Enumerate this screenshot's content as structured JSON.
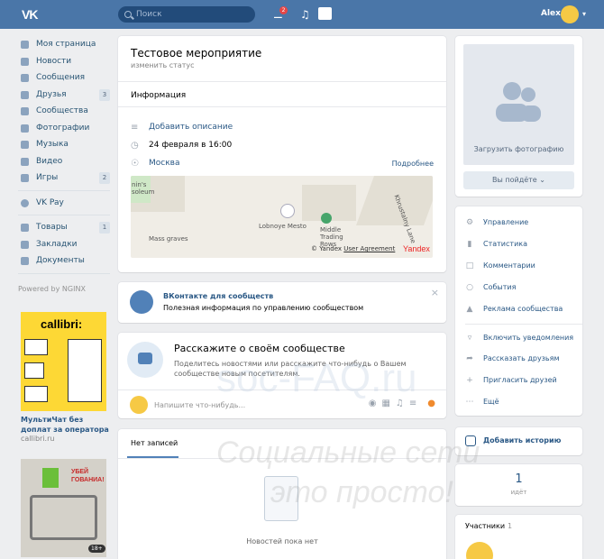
{
  "topbar": {
    "logo": "VK",
    "search_placeholder": "Поиск",
    "notif_count": "2",
    "user_name": "Alex"
  },
  "sidebar": {
    "items": [
      {
        "label": "Моя страница",
        "count": ""
      },
      {
        "label": "Новости",
        "count": ""
      },
      {
        "label": "Сообщения",
        "count": ""
      },
      {
        "label": "Друзья",
        "count": "3"
      },
      {
        "label": "Сообщества",
        "count": ""
      },
      {
        "label": "Фотографии",
        "count": ""
      },
      {
        "label": "Музыка",
        "count": ""
      },
      {
        "label": "Видео",
        "count": ""
      },
      {
        "label": "Игры",
        "count": "2"
      }
    ],
    "vkpay": "VK Pay",
    "items2": [
      {
        "label": "Товары",
        "count": "1"
      },
      {
        "label": "Закладки",
        "count": ""
      },
      {
        "label": "Документы",
        "count": ""
      }
    ],
    "powered": "Powered by NGINX",
    "ad1": {
      "title": "callibri:",
      "caption": "МультиЧат без доплат за оператора",
      "url": "callibri.ru"
    },
    "ad2": {
      "title": "УБЕЙ ГОВАНИА!",
      "age": "18+"
    }
  },
  "event": {
    "title": "Тестовое мероприятие",
    "status": "изменить статус",
    "info_label": "Информация",
    "add_desc": "Добавить описание",
    "date": "24 февраля в 16:00",
    "city": "Москва",
    "more": "Подробнее",
    "map": {
      "lbl1": "nin's",
      "lbl2": "soleum",
      "lbl3": "Mass graves",
      "lbl4": "Lobnoye Mesto",
      "lbl5": "Middle Trading Rows",
      "lbl6": "Khrustalny Lane",
      "copyright": "© Yandex",
      "agreement": "User Agreement",
      "yandex": "Yandex"
    }
  },
  "community_info": {
    "title": "ВКонтакте для сообществ",
    "subtitle": "Полезная информация по управлению сообществом",
    "close": "×"
  },
  "tell": {
    "title": "Расскажите о своём сообществе",
    "subtitle": "Поделитесь новостями или расскажите что-нибудь о Вашем сообществе новым посетителям.",
    "placeholder": "Напишите что-нибудь..."
  },
  "posts": {
    "tab": "Нет записей",
    "empty": "Новостей пока нет"
  },
  "photo": {
    "upload": "Загрузить фотографию",
    "go_button": "Вы пойдёте"
  },
  "menu": {
    "items": [
      "Управление",
      "Статистика",
      "Комментарии",
      "События",
      "Реклама сообщества"
    ],
    "items2": [
      "Включить уведомления",
      "Рассказать друзьям",
      "Пригласить друзей",
      "Ещё"
    ]
  },
  "story": {
    "label": "Добавить историю"
  },
  "going": {
    "count": "1",
    "label": "идёт"
  },
  "members": {
    "label": "Участники",
    "count": "1"
  },
  "watermark": {
    "line1": "soc-FAQ.ru",
    "line2": "Социальные сети",
    "line3": "это просто!"
  }
}
